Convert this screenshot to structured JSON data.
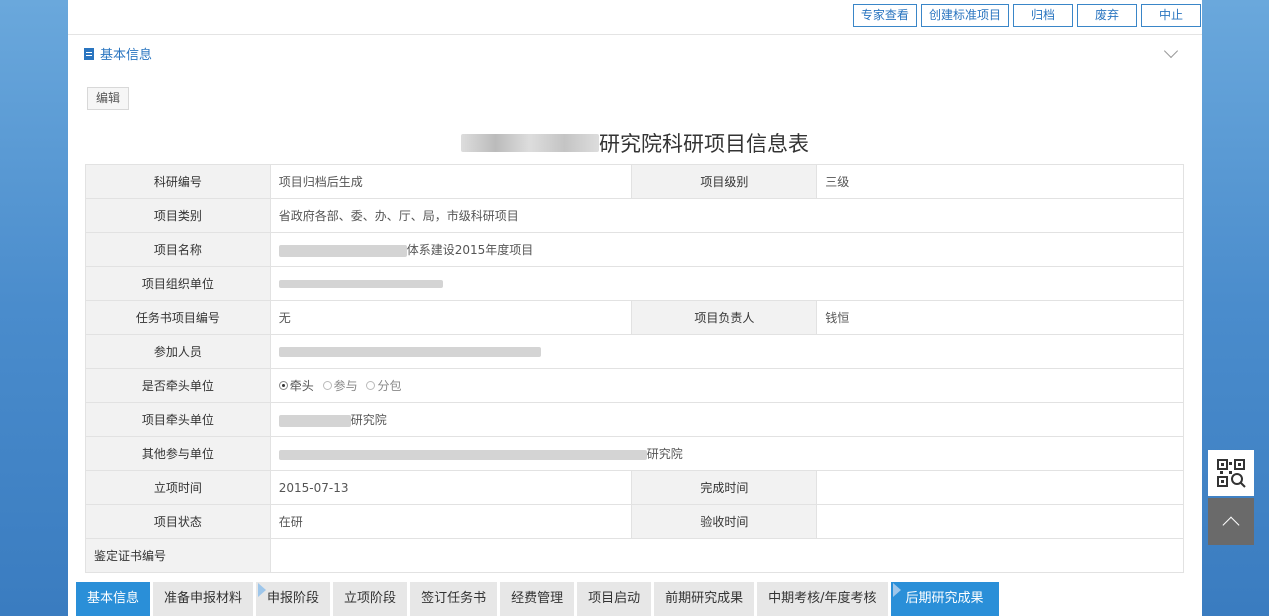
{
  "top_actions": [
    "专家查看",
    "创建标准项目",
    "归档",
    "废弃",
    "中止"
  ],
  "section": {
    "title": "基本信息"
  },
  "edit_label": "编辑",
  "form_title": "研究院科研项目信息表",
  "rows": {
    "research_no": {
      "label": "科研编号",
      "value": "项目归档后生成"
    },
    "level": {
      "label": "项目级别",
      "value": "三级"
    },
    "category": {
      "label": "项目类别",
      "value": "省政府各部、委、办、厅、局，市级科研项目"
    },
    "name": {
      "label": "项目名称",
      "value": "体系建设2015年度项目"
    },
    "org_unit": {
      "label": "项目组织单位",
      "value": ""
    },
    "task_no": {
      "label": "任务书项目编号",
      "value": "无"
    },
    "leader": {
      "label": "项目负责人",
      "value": "钱恒"
    },
    "members": {
      "label": "参加人员",
      "value": ""
    },
    "is_lead": {
      "label": "是否牵头单位",
      "options": [
        "牵头",
        "参与",
        "分包"
      ],
      "selected": "牵头"
    },
    "lead_unit": {
      "label": "项目牵头单位",
      "value": "研究院"
    },
    "other_units": {
      "label": "其他参与单位",
      "value": "研究院"
    },
    "start_date": {
      "label": "立项时间",
      "value": "2015-07-13"
    },
    "finish_date": {
      "label": "完成时间",
      "value": ""
    },
    "status": {
      "label": "项目状态",
      "value": "在研"
    },
    "accept_date": {
      "label": "验收时间",
      "value": ""
    },
    "cert_no": {
      "label": "鉴定证书编号",
      "value": ""
    }
  },
  "bottom_tabs": [
    "基本信息",
    "准备申报材料",
    "申报阶段",
    "立项阶段",
    "签订任务书",
    "经费管理",
    "项目启动",
    "前期研究成果",
    "中期考核/年度考核",
    "后期研究成果"
  ],
  "colors": {
    "accent": "#2a8fd8",
    "link": "#2a75c0",
    "warning_text": "#e32222"
  },
  "icons": {
    "section": "document-icon",
    "collapse": "chevron-down-icon",
    "side_qr": "qr-code-icon",
    "side_top": "arrow-up-icon"
  }
}
